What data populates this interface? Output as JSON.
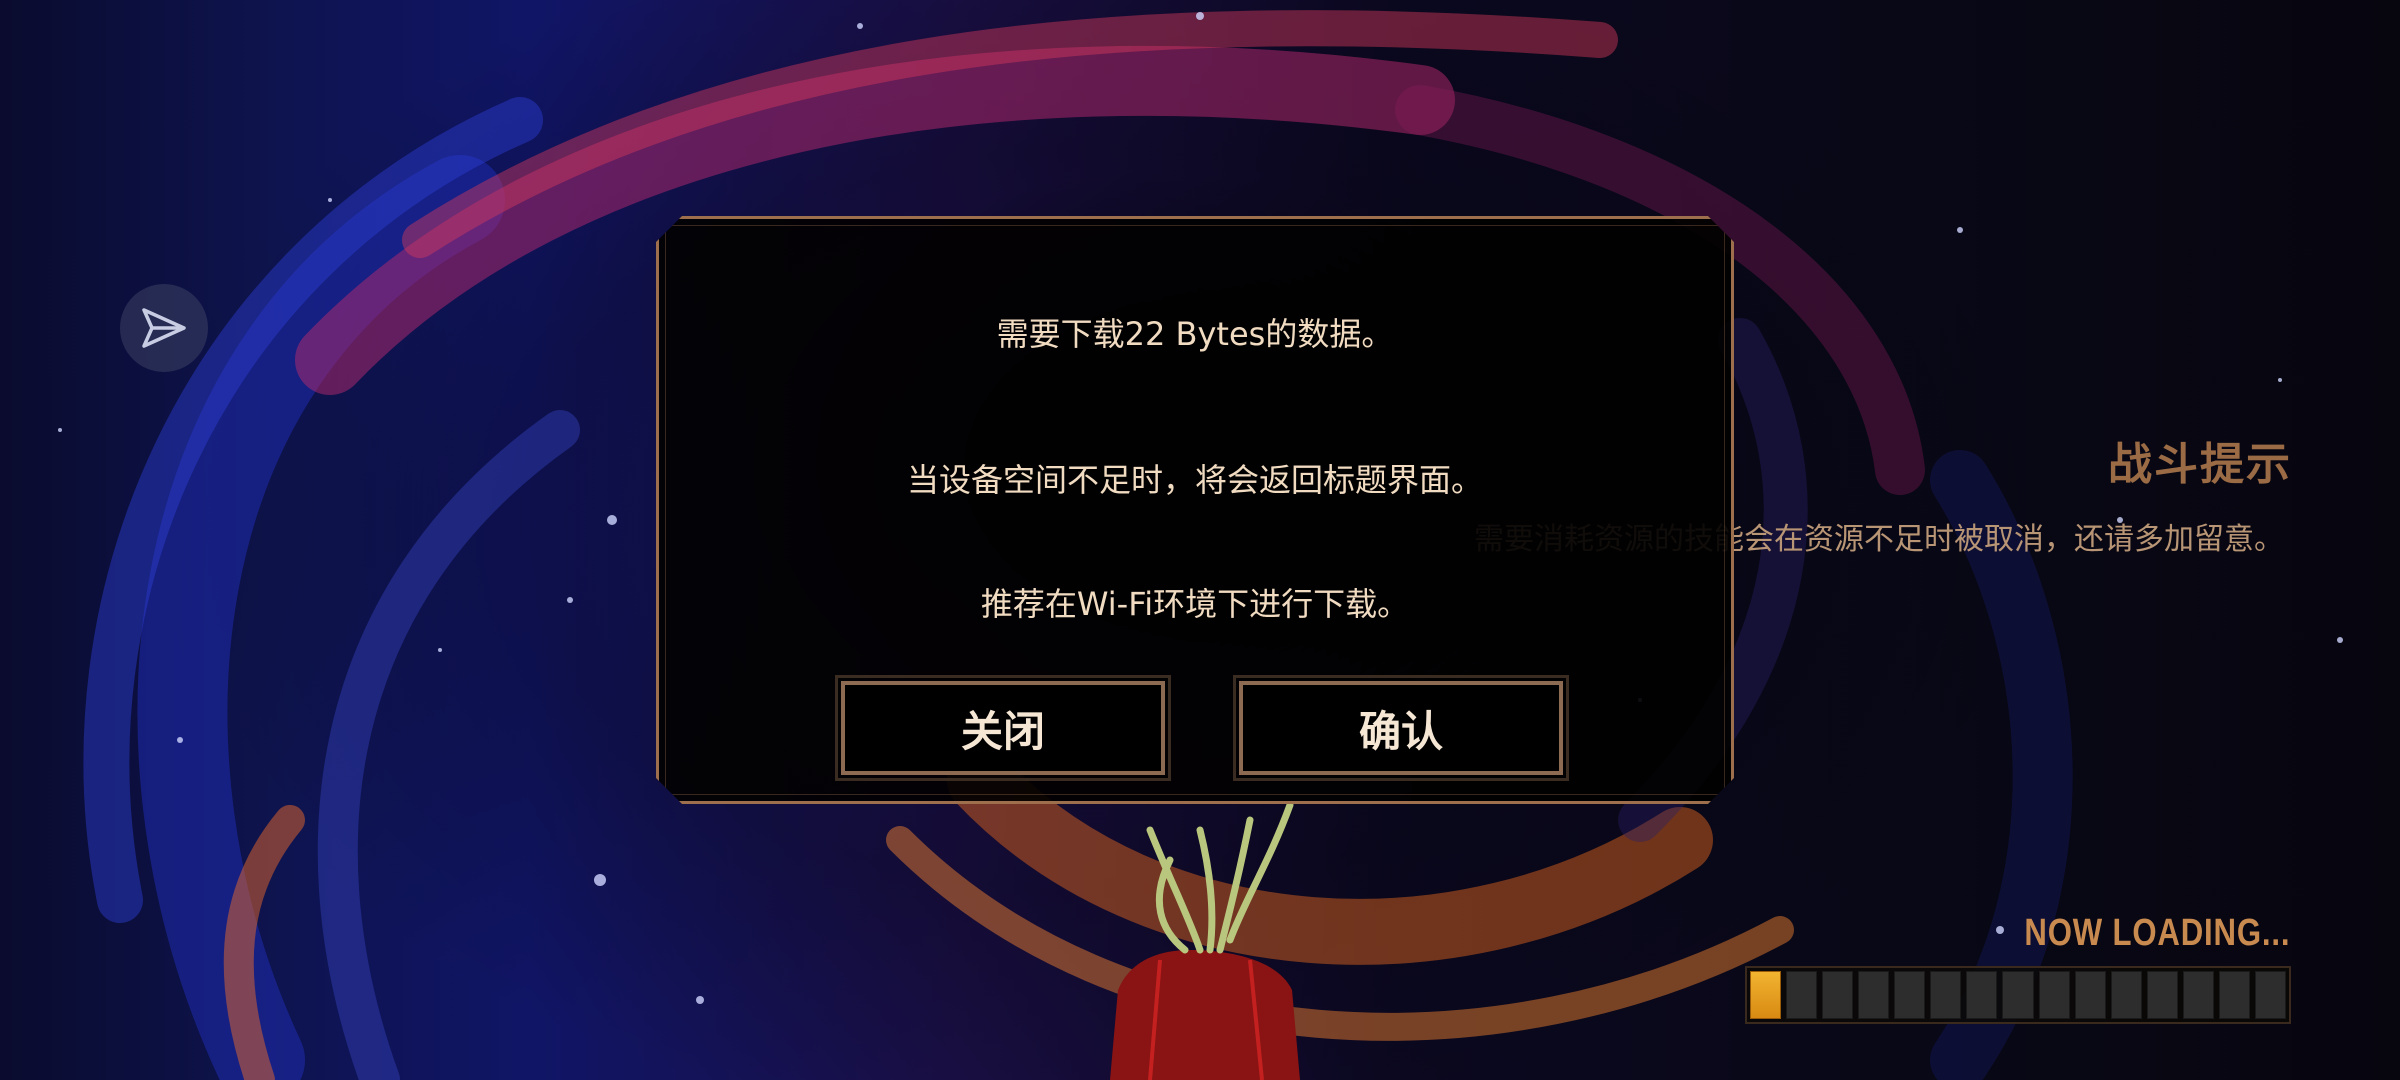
{
  "dialog": {
    "line1": "需要下载22 Bytes的数据。",
    "line2": "当设备空间不足时，将会返回标题界面。",
    "line3": "推荐在Wi-Fi环境下进行下载。",
    "close_label": "关闭",
    "confirm_label": "确认"
  },
  "tip": {
    "title": "战斗提示",
    "text": "需要消耗资源的技能会在资源不足时被取消，还请多加留意。"
  },
  "loading": {
    "label": "NOW LOADING...",
    "segments_total": 15,
    "segments_filled": 1
  },
  "icons": {
    "share": "send-arrow-icon"
  },
  "colors": {
    "accent": "#9e6f4d",
    "dialog_text": "#f1dcc2",
    "tip_title": "#9b6b45",
    "loading_label": "#c98a4f",
    "progress_fill": "#f2b431"
  }
}
